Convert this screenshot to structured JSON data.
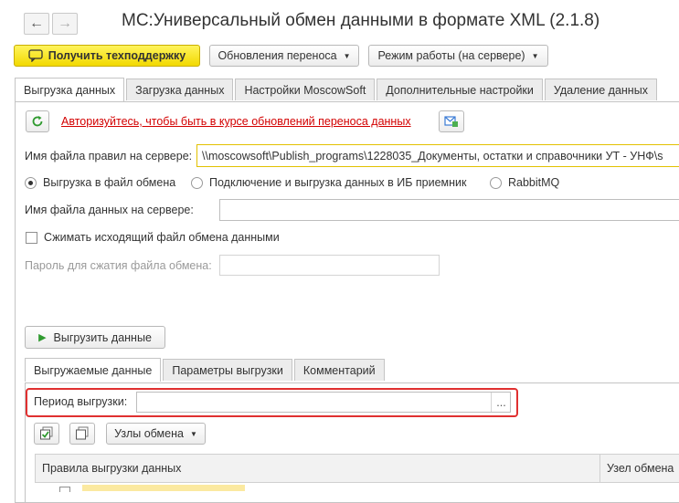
{
  "window": {
    "title": "МС:Универсальный обмен данными в формате XML (2.1.8)"
  },
  "toolbar": {
    "support_button": "Получить техподдержку",
    "updates_button": "Обновления переноса",
    "mode_button": "Режим работы (на сервере)"
  },
  "main_tabs": [
    {
      "label": "Выгрузка данных",
      "active": true
    },
    {
      "label": "Загрузка данных",
      "active": false
    },
    {
      "label": "Настройки MoscowSoft",
      "active": false
    },
    {
      "label": "Дополнительные настройки",
      "active": false
    },
    {
      "label": "Удаление данных",
      "active": false
    }
  ],
  "export": {
    "auth_link": "Авторизуйтесь, чтобы быть в курсе обновлений переноса данных",
    "rules_file_label": "Имя файла правил на сервере:",
    "rules_file_value": "\\\\moscowsoft\\Publish_programs\\1228035_Документы, остатки и справочники УТ - УНФ\\s",
    "radio_options": [
      {
        "label": "Выгрузка в файл обмена",
        "selected": true
      },
      {
        "label": "Подключение и выгрузка данных в ИБ приемник",
        "selected": false
      },
      {
        "label": "RabbitMQ",
        "selected": false
      }
    ],
    "data_file_label": "Имя файла данных на сервере:",
    "data_file_value": "",
    "compress_label": "Сжимать исходящий файл обмена данными",
    "compress_checked": false,
    "password_label": "Пароль для сжатия файла обмена:",
    "password_value": "",
    "export_button": "Выгрузить данные"
  },
  "sub_tabs": [
    {
      "label": "Выгружаемые данные",
      "active": true
    },
    {
      "label": "Параметры выгрузки",
      "active": false
    },
    {
      "label": "Комментарий",
      "active": false
    }
  ],
  "period": {
    "label": "Период выгрузки:",
    "value": "",
    "select_button": "..."
  },
  "nodes_button": "Узлы обмена",
  "table": {
    "columns": [
      "Правила выгрузки данных",
      "Узел обмена"
    ]
  }
}
